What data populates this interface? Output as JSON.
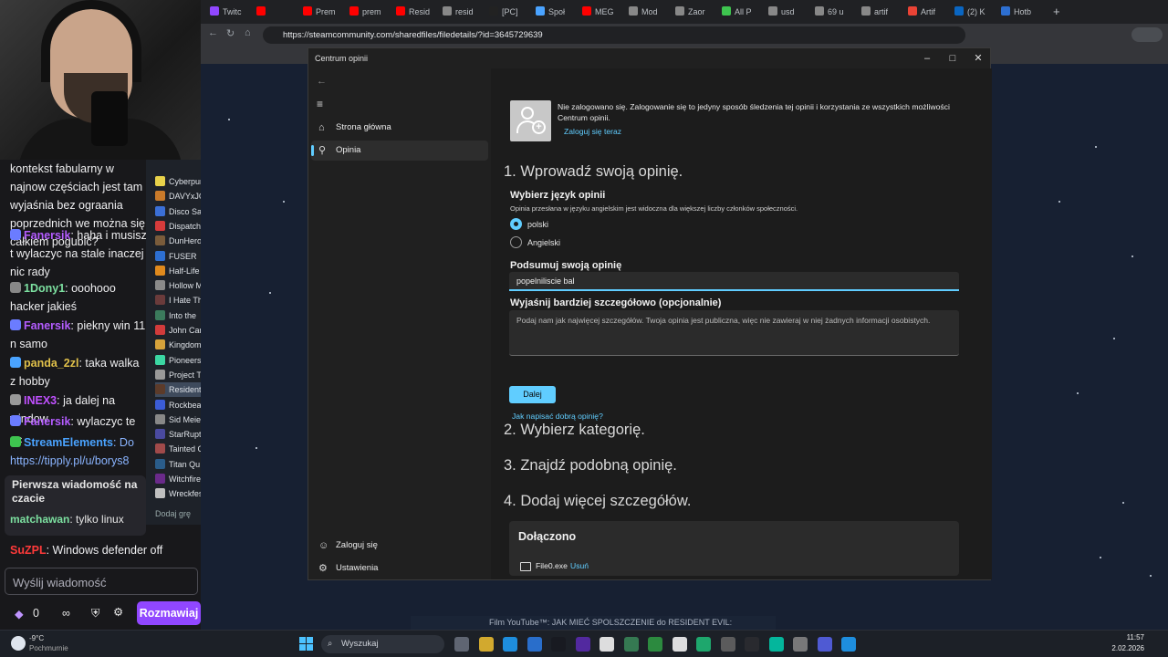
{
  "stream": {
    "chat": {
      "messages": [
        {
          "user": "",
          "text": "kontekst fabularny w najnow częściach jest tam wyjaśnia bez ograania poprzednich we można się całkiem pogubić?"
        },
        {
          "user": "Fanersik",
          "text": ": haha i musisz t wylaczyc na stale inaczej nic rady"
        },
        {
          "user": "1Dony1",
          "text": ": ooohooo hacker jakieś"
        },
        {
          "user": "Fanersik",
          "text": ": piekny win 11 n samo"
        },
        {
          "user": "panda_2zl",
          "text": ": taka walka z hobby"
        },
        {
          "user": "INEX3",
          "text": ": ja dalej na window"
        },
        {
          "user": "Fanersik",
          "text": ": wylaczyc te oc"
        },
        {
          "user": "StreamElements",
          "text": ": Do https://tipply.pl/u/borys8"
        }
      ],
      "pinned_title": "Pierwsza wiadomość na czacie",
      "pinned_user": "matchawan",
      "pinned_text": ": tylko linux",
      "last_user": "SuZPL",
      "last_text": ": Windows defender off",
      "input_placeholder": "Wyślij wiadomość",
      "points": "0",
      "infinity": "∞",
      "send_label": "Rozmawiaj"
    },
    "games": [
      "Cyberpun",
      "DAVYxJO",
      "Disco Sa",
      "Dispatch",
      "DunHero",
      "FUSER",
      "Half-Life",
      "Hollow M",
      "I Hate Th",
      "Into the",
      "John Car",
      "Kingdom",
      "Pioneers",
      "Project T",
      "Resident",
      "Rockbea",
      "Sid Meier",
      "StarRupt",
      "Tainted C",
      "Titan Qu",
      "Witchfire",
      "Wreckfes"
    ],
    "add_game_label": "Dodaj grę"
  },
  "browser": {
    "tabs": [
      "Twitc",
      "",
      "Prem",
      "prem",
      "Resid",
      "resid",
      "[PC]",
      "Społ",
      "MEG",
      "Mod",
      "Zaor",
      "All P",
      "usd",
      "69 u",
      "artif",
      "Artif",
      "(2) K",
      "Hotb"
    ],
    "url": "https://steamcommunity.com/sharedfiles/filedetails/?id=3645729639",
    "youtube_bar": "Film YouTube™: JAK MIEĆ SPOLSZCZENIE do RESIDENT EVIL:"
  },
  "feedback_hub": {
    "window_title": "Centrum opinii",
    "nav": {
      "home": "Strona główna",
      "feedback": "Opinia",
      "sign_in": "Zaloguj się",
      "settings": "Ustawienia"
    },
    "signin_notice": "Nie zalogowano się. Zalogowanie się to jedyny sposób śledzenia tej opinii i korzystania ze wszystkich możliwości Centrum opinii.",
    "signin_link": "Zaloguj się teraz",
    "step1": "1. Wprowadź swoją opinię.",
    "lang_heading": "Wybierz język opinii",
    "lang_hint": "Opinia przesłana w języku angielskim jest widoczna dla większej liczby członków społeczności.",
    "lang_options": [
      "polski",
      "Angielski"
    ],
    "summary_heading": "Podsumuj swoją opinię",
    "summary_value": "popelniliscie bal",
    "details_heading": "Wyjaśnij bardziej szczegółowo (opcjonalnie)",
    "details_placeholder": "Podaj nam jak najwięcej szczegółów. Twoja opinia jest publiczna, więc nie zawieraj w niej żadnych informacji osobistych.",
    "help_link": "Jak napisać dobrą opinię?",
    "next_button": "Dalej",
    "step2": "2. Wybierz kategorię.",
    "step3": "3. Znajdź podobną opinię.",
    "step4": "4. Dodaj więcej szczegółów.",
    "attached_heading": "Dołączono",
    "attached_file": "File0.exe",
    "remove_link": "Usuń"
  },
  "taskbar": {
    "weather_temp": "-9°C",
    "weather_desc": "Pochmurnie",
    "search": "Wyszukaj",
    "time": "11:57",
    "date": "2.02.2026"
  },
  "colors": {
    "accent": "#60cdff",
    "twitch": "#9147ff"
  }
}
